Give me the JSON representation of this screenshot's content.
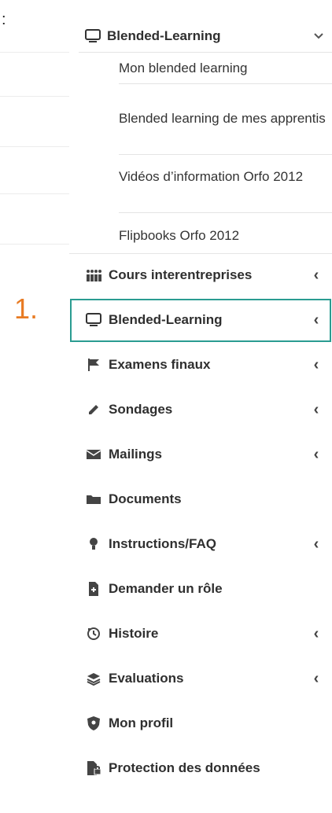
{
  "colon": ":",
  "step_label": "1.",
  "expanded_section": {
    "title": "Blended-Learning",
    "icon": "monitor-icon",
    "chevron": "⌄",
    "items": [
      "Mon blended learning",
      "Blended learning de mes apprentis",
      "Vidéos d’information Orfo 2012",
      "Flipbooks Orfo 2012"
    ]
  },
  "menu": [
    {
      "label": "Cours interentreprises",
      "icon": "users-icon",
      "chevron": "‹"
    },
    {
      "label": "Blended-Learning",
      "icon": "monitor-icon",
      "chevron": "‹",
      "selected": true
    },
    {
      "label": "Examens finaux",
      "icon": "flag-icon",
      "chevron": "‹"
    },
    {
      "label": "Sondages",
      "icon": "pencil-icon",
      "chevron": "‹"
    },
    {
      "label": "Mailings",
      "icon": "envelope-icon",
      "chevron": "‹"
    },
    {
      "label": "Documents",
      "icon": "folder-icon"
    },
    {
      "label": "Instructions/FAQ",
      "icon": "lightbulb-icon",
      "chevron": "‹"
    },
    {
      "label": "Demander un rôle",
      "icon": "file-plus-icon"
    },
    {
      "label": "Histoire",
      "icon": "history-icon",
      "chevron": "‹"
    },
    {
      "label": "Evaluations",
      "icon": "layers-icon",
      "chevron": "‹"
    },
    {
      "label": "Mon profil",
      "icon": "shield-icon"
    },
    {
      "label": "Protection des données",
      "icon": "file-lock-icon"
    }
  ]
}
